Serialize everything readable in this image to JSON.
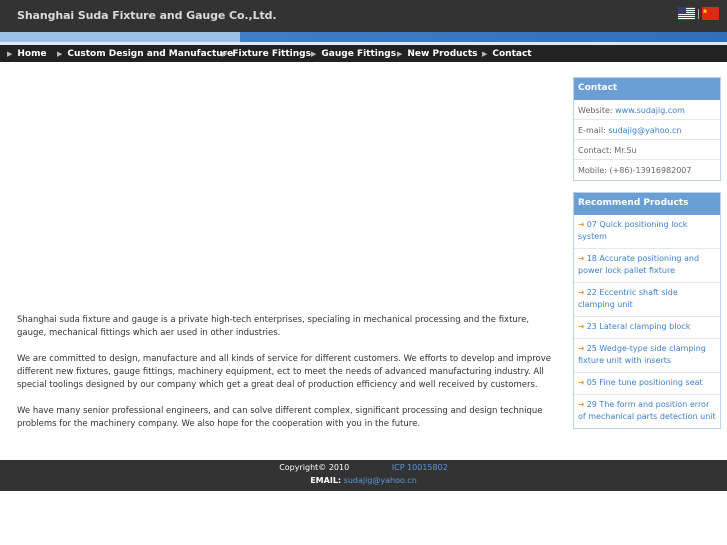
{
  "header": {
    "title": "Shanghai Suda Fixture and Gauge Co.,Ltd.",
    "flags": [
      "us-flag-icon",
      "cn-flag-icon"
    ]
  },
  "nav": {
    "items": [
      {
        "label": "Home"
      },
      {
        "label": "Custom Design and Manufacture"
      },
      {
        "label": "Fixture Fittings"
      },
      {
        "label": "Gauge Fittings"
      },
      {
        "label": "New Products"
      },
      {
        "label": "Contact"
      }
    ]
  },
  "main": {
    "paragraphs": [
      "Shanghai suda fixture and gauge is a private high-tech enterprises, specialing in mechanical processing and the fixture, gauge, mechanical fittings which aer used in other industries.",
      "We are committed to design, manufacture and all kinds of service for different customers. We efforts to develop and improve different new fixtures, gauge fittings, machinery equipment, ect to meet the needs of advanced manufacturing industry. All special toolings designed by our company which get a great deal of production efficiency and well received by customers.",
      "We have many senior professional engineers, and can solve different complex, significant processing and design technique problems for the machinery company. We also hope for the cooperation with you in the future."
    ]
  },
  "contact": {
    "title": "Contact",
    "website_label": "Website: ",
    "website": "www.sudajig.com",
    "email_label": "E-mail: ",
    "email": "sudajig@yahoo.cn",
    "contact": "Contact: Mr.Su",
    "mobile": "Mobile: (+86)-13916982007"
  },
  "recommend": {
    "title": "Recommend Products",
    "items": [
      "07 Quick positioning lock system",
      "18 Accurate positioning and power lock pallet fixture",
      "22 Eccentric shaft side clamping unit",
      "23 Lateral clamping block",
      "25 Wedge-type side clamping fixture unit with inserts",
      "05 Fine tune positioning seat",
      "29 The form and position error of mechanical parts detection unit"
    ]
  },
  "footer": {
    "copyright": "Copyright© 2010",
    "icp": "ICP 10015802",
    "email_label": "EMAIL:",
    "email": "sudajig@yahoo.cn"
  },
  "colors": {
    "header_bg": "#333333",
    "accent_blue": "#3f7fc6",
    "box_title_bg": "#6a9fd6",
    "arrow_orange": "#e5a042"
  }
}
